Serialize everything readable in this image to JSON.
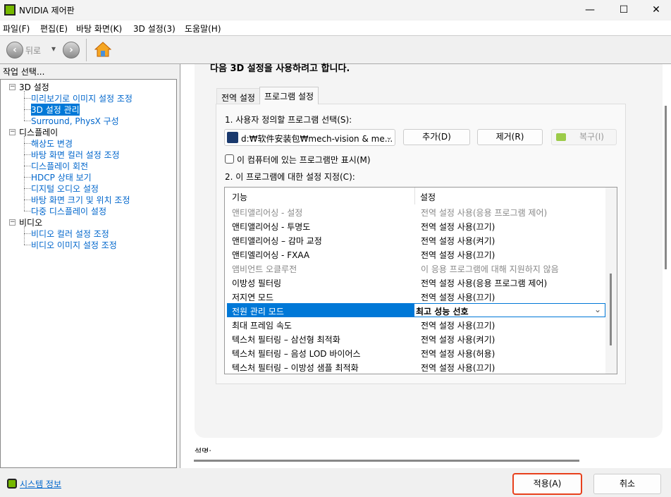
{
  "window": {
    "title": "NVIDIA 제어판",
    "minimize": "—",
    "maximize": "☐",
    "close": "✕"
  },
  "menu": [
    "파일(F)",
    "편집(E)",
    "바탕 화면(K)",
    "3D 설정(3)",
    "도움말(H)"
  ],
  "toolbar": {
    "back_label": "뒤로",
    "dropdown": "▾",
    "back_icon": "arrow-left-icon",
    "forward_icon": "arrow-right-icon",
    "home_icon": "home-icon"
  },
  "sidebar": {
    "header": "작업 선택...",
    "groups": [
      {
        "label": "3D 설정",
        "items": [
          "미리보기로 이미지 설정 조정",
          "3D 설정 관리",
          "Surround, PhysX 구성"
        ]
      },
      {
        "label": "디스플레이",
        "items": [
          "해상도 변경",
          "바탕 화면 컬러 설정 조정",
          "디스플레이 회전",
          "HDCP 상태 보기",
          "디지털 오디오 설정",
          "바탕 화면 크기 및 위치 조정",
          "다중 디스플레이 설정"
        ]
      },
      {
        "label": "비디오",
        "items": [
          "비디오 컬러 설정 조정",
          "비디오 이미지 설정 조정"
        ]
      }
    ],
    "selected": "3D 설정 관리"
  },
  "main": {
    "heading": "다음 3D 설정을 사용하려고 합니다.",
    "tabs": [
      {
        "label": "전역 설정"
      },
      {
        "label": "프로그램 설정",
        "active": true
      }
    ],
    "step1": "1. 사용자 정의할 프로그램 선택(S):",
    "program": "d:₩软件安装包₩mech-vision & me...",
    "add": "추가(D)",
    "remove": "제거(R)",
    "restore": "복구(I)",
    "checkbox": {
      "label": "이 컴퓨터에 있는 프로그램만 표시(M)",
      "checked": false
    },
    "step2": "2. 이 프로그램에 대한 설정 지정(C):",
    "table": {
      "headers": [
        "기능",
        "설정"
      ],
      "rows": [
        {
          "feature": "앤티앨리어싱 - 설정",
          "setting": "전역 설정 사용(응용 프로그램 제어)",
          "dim": true
        },
        {
          "feature": "앤티앨리어싱 - 투명도",
          "setting": "전역 설정 사용(끄기)"
        },
        {
          "feature": "앤티앨리어싱 – 감마 교정",
          "setting": "전역 설정 사용(켜기)"
        },
        {
          "feature": "앤티엘리어싱 - FXAA",
          "setting": "전역 설정 사용(끄기)"
        },
        {
          "feature": "앰비언트 오클루전",
          "setting": "이 응용 프로그램에 대해 지원하지 않음",
          "dim": true
        },
        {
          "feature": "이방성 필터링",
          "setting": "전역 설정 사용(응용 프로그램 제어)"
        },
        {
          "feature": "저지연 모드",
          "setting": "전역 설정 사용(끄기)"
        },
        {
          "feature": "전원 관리 모드",
          "setting": "최고 성능 선호",
          "selected": true
        },
        {
          "feature": "최대 프레임 속도",
          "setting": "전역 설정 사용(끄기)"
        },
        {
          "feature": "텍스처 필터링 – 삼선형 최적화",
          "setting": "전역 설정 사용(켜기)"
        },
        {
          "feature": "텍스처 필터링 – 음성 LOD 바이어스",
          "setting": "전역 설정 사용(허용)"
        },
        {
          "feature": "텍스처 필터링 – 이방성 샘플 최적화",
          "setting": "전역 설정 사용(끄기)"
        }
      ]
    },
    "description_label": "설명:"
  },
  "footer": {
    "system_info": "시스템 정보",
    "apply": "적용(A)",
    "cancel": "취소"
  },
  "colors": {
    "accent": "#0078d7",
    "link": "#0066cc",
    "highlight_border": "#e8401c",
    "nvidia_green": "#76b900"
  }
}
